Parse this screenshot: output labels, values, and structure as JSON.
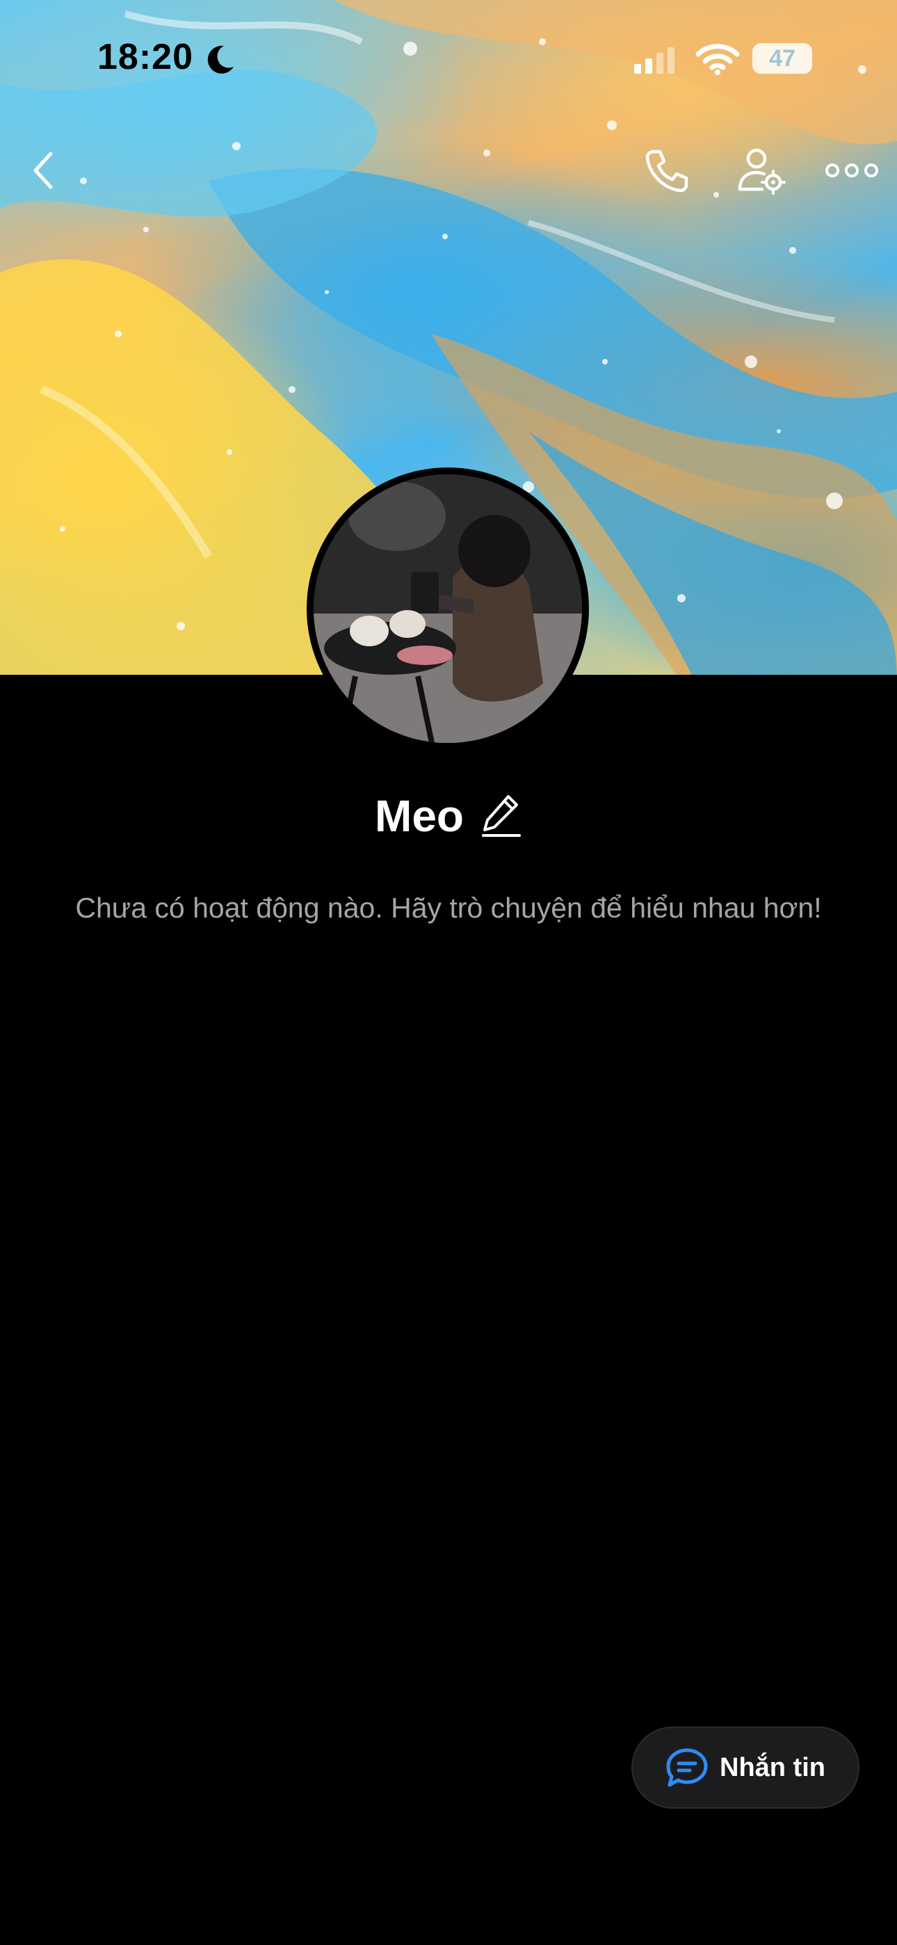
{
  "status_bar": {
    "time": "18:20",
    "battery": "47"
  },
  "header": {
    "back_icon": "chevron-left-icon",
    "call_icon": "phone-icon",
    "settings_icon": "user-gear-icon",
    "more_icon": "more-dots-icon"
  },
  "profile": {
    "name": "Meo",
    "edit_icon": "pencil-icon",
    "empty_message": "Chưa có hoạt động nào. Hãy trò chuyện để hiểu nhau hơn!"
  },
  "fab": {
    "label": "Nhắn tin",
    "icon": "chat-bubble-icon",
    "icon_color": "#2e8cf5"
  }
}
